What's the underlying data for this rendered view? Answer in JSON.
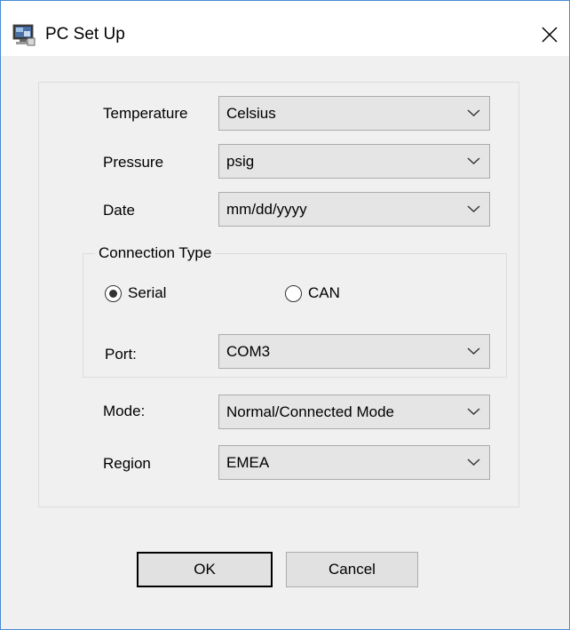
{
  "window": {
    "title": "PC Set Up",
    "icon": "app-monitor-icon",
    "close_icon": "close-icon"
  },
  "form": {
    "temperature": {
      "label": "Temperature",
      "value": "Celsius"
    },
    "pressure": {
      "label": "Pressure",
      "value": "psig"
    },
    "date": {
      "label": "Date",
      "value": "mm/dd/yyyy"
    },
    "connection": {
      "legend": "Connection Type",
      "serial_label": "Serial",
      "can_label": "CAN",
      "selected": "Serial",
      "port": {
        "label": "Port:",
        "value": "COM3"
      }
    },
    "mode": {
      "label": "Mode:",
      "value": "Normal/Connected Mode"
    },
    "region": {
      "label": "Region",
      "value": "EMEA"
    }
  },
  "buttons": {
    "ok_label": "OK",
    "cancel_label": "Cancel"
  },
  "colors": {
    "window_border": "#4a8bd6",
    "dialog_bg": "#f0f0f0",
    "combo_bg": "#e5e5e5"
  }
}
